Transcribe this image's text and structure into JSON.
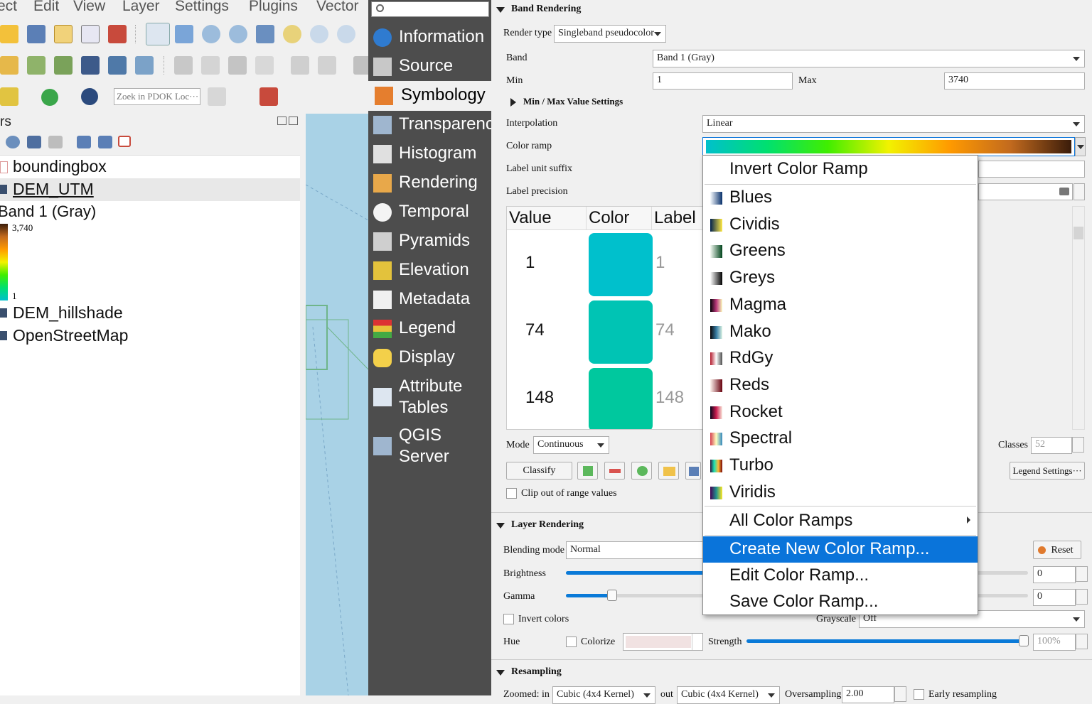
{
  "menubar": [
    "ect",
    "Edit",
    "View",
    "Layer",
    "Settings",
    "Plugins",
    "Vector"
  ],
  "locator": {
    "placeholder": "Zoek in PDOK Loc···"
  },
  "layers_panel": {
    "title": "rs",
    "items": [
      {
        "name": "boundingbox"
      },
      {
        "name": "DEM_UTM"
      },
      {
        "name": "DEM_hillshade"
      },
      {
        "name": "OpenStreetMap"
      }
    ],
    "legend": {
      "band": "Band 1 (Gray)",
      "max": "3,740",
      "min": "1"
    }
  },
  "sidebar": {
    "items": [
      {
        "label": "Information",
        "icon": "info-icon"
      },
      {
        "label": "Source",
        "icon": "source-icon"
      },
      {
        "label": "Symbology",
        "icon": "paintbrush-icon"
      },
      {
        "label": "Transparency",
        "icon": "transparency-icon"
      },
      {
        "label": "Histogram",
        "icon": "histogram-icon"
      },
      {
        "label": "Rendering",
        "icon": "rendering-icon"
      },
      {
        "label": "Temporal",
        "icon": "clock-icon"
      },
      {
        "label": "Pyramids",
        "icon": "pyramids-icon"
      },
      {
        "label": "Elevation",
        "icon": "elevation-icon"
      },
      {
        "label": "Metadata",
        "icon": "metadata-icon"
      },
      {
        "label": "Legend",
        "icon": "legend-icon"
      },
      {
        "label": "Display",
        "icon": "display-icon"
      },
      {
        "label": "Attribute",
        "label2": "Tables",
        "icon": "table-icon"
      },
      {
        "label": "QGIS",
        "label2": "Server",
        "icon": "server-icon"
      }
    ],
    "active": "Symbology"
  },
  "band_rendering": {
    "title": "Band Rendering",
    "render_type_label": "Render type",
    "render_type": "Singleband pseudocolor",
    "band_label": "Band",
    "band": "Band 1 (Gray)",
    "min_label": "Min",
    "min": "1",
    "max_label": "Max",
    "max": "3740",
    "minmax_settings": "Min / Max Value Settings",
    "interpolation_label": "Interpolation",
    "interpolation": "Linear",
    "color_ramp_label": "Color ramp",
    "label_unit_suffix_label": "Label unit suffix",
    "label_precision_label": "Label precision",
    "table": {
      "headers": [
        "Value",
        "Color",
        "Label"
      ],
      "rows": [
        {
          "value": "1",
          "color": "#00c0cc",
          "label": "1"
        },
        {
          "value": "74",
          "color": "#00c4b4",
          "label": "74"
        },
        {
          "value": "148",
          "color": "#00c89e",
          "label": "148"
        }
      ]
    },
    "mode_label": "Mode",
    "mode": "Continuous",
    "classes_label": "Classes",
    "classes": "52",
    "classify_button": "Classify",
    "legend_settings_button": "Legend Settings···",
    "clip_label": "Clip out of range values"
  },
  "layer_rendering": {
    "title": "Layer Rendering",
    "blending_label": "Blending mode",
    "blending": "Normal",
    "reset_button": "Reset",
    "brightness_label": "Brightness",
    "brightness": "0",
    "brightness_level": 0.5,
    "gamma_label": "Gamma",
    "gamma": "0",
    "gamma_level": 0.1,
    "invert_label": "Invert colors",
    "grayscale_label": "Grayscale",
    "grayscale": "Off",
    "hue_label": "Hue",
    "colorize_label": "Colorize",
    "strength_label": "Strength",
    "strength": "100%",
    "strength_level": 1.0
  },
  "resampling": {
    "title": "Resampling",
    "zoomed_in_label": "Zoomed: in",
    "zoomed_in": "Cubic (4x4 Kernel)",
    "out_label": "out",
    "out": "Cubic (4x4 Kernel)",
    "oversampling_label": "Oversampling",
    "oversampling": "2.00",
    "early_label": "Early resampling"
  },
  "color_ramp_menu": {
    "invert": "Invert Color Ramp",
    "ramps": [
      {
        "name": "Blues",
        "colors": [
          "#f7fbff",
          "#08306b"
        ]
      },
      {
        "name": "Cividis",
        "colors": [
          "#00204d",
          "#ffea46"
        ]
      },
      {
        "name": "Greens",
        "colors": [
          "#f7fcf5",
          "#00441b"
        ]
      },
      {
        "name": "Greys",
        "colors": [
          "#ffffff",
          "#000000"
        ]
      },
      {
        "name": "Magma",
        "colors": [
          "#000004",
          "#b73779",
          "#fcfdbf"
        ]
      },
      {
        "name": "Mako",
        "colors": [
          "#0b0405",
          "#357ba2",
          "#def5e5"
        ]
      },
      {
        "name": "RdGy",
        "colors": [
          "#b2182b",
          "#ffffff",
          "#4d4d4d"
        ]
      },
      {
        "name": "Reds",
        "colors": [
          "#fff5f0",
          "#67000d"
        ]
      },
      {
        "name": "Rocket",
        "colors": [
          "#03051a",
          "#cb1b4f",
          "#faebdd"
        ]
      },
      {
        "name": "Spectral",
        "colors": [
          "#d53e4f",
          "#ffffbf",
          "#3288bd"
        ]
      },
      {
        "name": "Turbo",
        "colors": [
          "#30123b",
          "#1ae4b6",
          "#fabA39",
          "#7a0403"
        ]
      },
      {
        "name": "Viridis",
        "colors": [
          "#440154",
          "#21918c",
          "#fde725"
        ]
      }
    ],
    "all_ramps": "All Color Ramps",
    "create_new": "Create New Color Ramp...",
    "edit": "Edit Color Ramp...",
    "save": "Save Color Ramp..."
  },
  "colors": {
    "accent": "#0a74da",
    "sidebar_bg": "#4d4d4d",
    "ramp": [
      "#00c0cc",
      "#00e070",
      "#40ee00",
      "#f2f200",
      "#ff9a00",
      "#c26a1e",
      "#3a1c0a"
    ]
  }
}
